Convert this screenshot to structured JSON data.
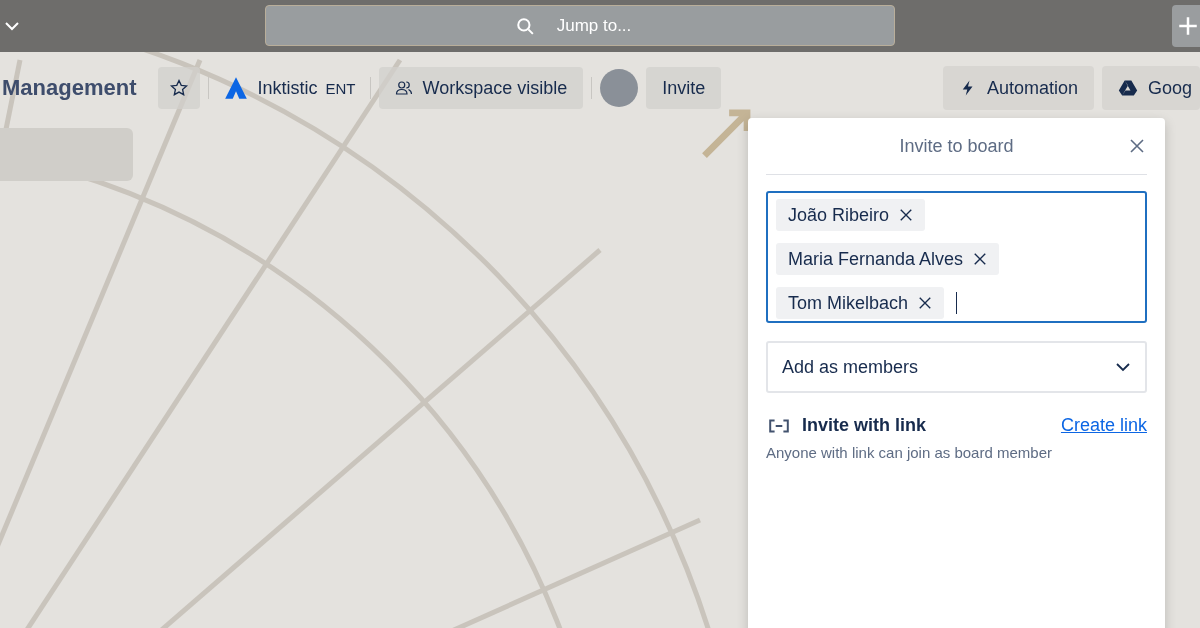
{
  "top_bar": {
    "search": {
      "placeholder": "Jump to..."
    }
  },
  "board_header": {
    "title": "Management",
    "starred": false,
    "workspace": {
      "name": "Inktistic",
      "badge": "ENT"
    },
    "visibility": "Workspace visible",
    "invite_button": "Invite",
    "automation_button": "Automation",
    "power_up_button": "Goog"
  },
  "invite_dialog": {
    "title": "Invite to board",
    "invitees": [
      {
        "name": "João Ribeiro"
      },
      {
        "name": "Maria Fernanda Alves"
      },
      {
        "name": "Tom Mikelbach"
      }
    ],
    "role_select": "Add as members",
    "link_section": {
      "title": "Invite with link",
      "action": "Create link",
      "description": "Anyone with link can join as board member"
    }
  }
}
